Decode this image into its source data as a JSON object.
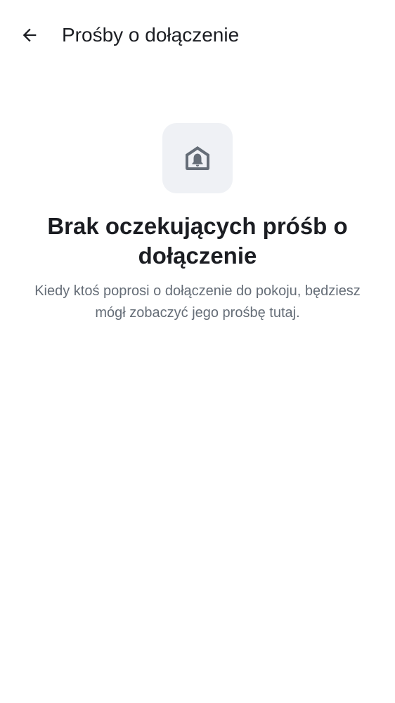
{
  "header": {
    "back_icon": "arrow-left-icon",
    "title": "Prośby o dołączenie"
  },
  "empty_state": {
    "icon": "home-bell-icon",
    "heading": "Brak oczekujących próśb o dołączenie",
    "description": "Kiedy ktoś poprosi o dołączenie do pokoju, będziesz mógł zobaczyć jego prośbę tutaj."
  },
  "colors": {
    "text_primary": "#1b1d22",
    "text_secondary": "#656d77",
    "icon_tile_background": "#eff1f5",
    "icon_foreground": "#656d77"
  }
}
